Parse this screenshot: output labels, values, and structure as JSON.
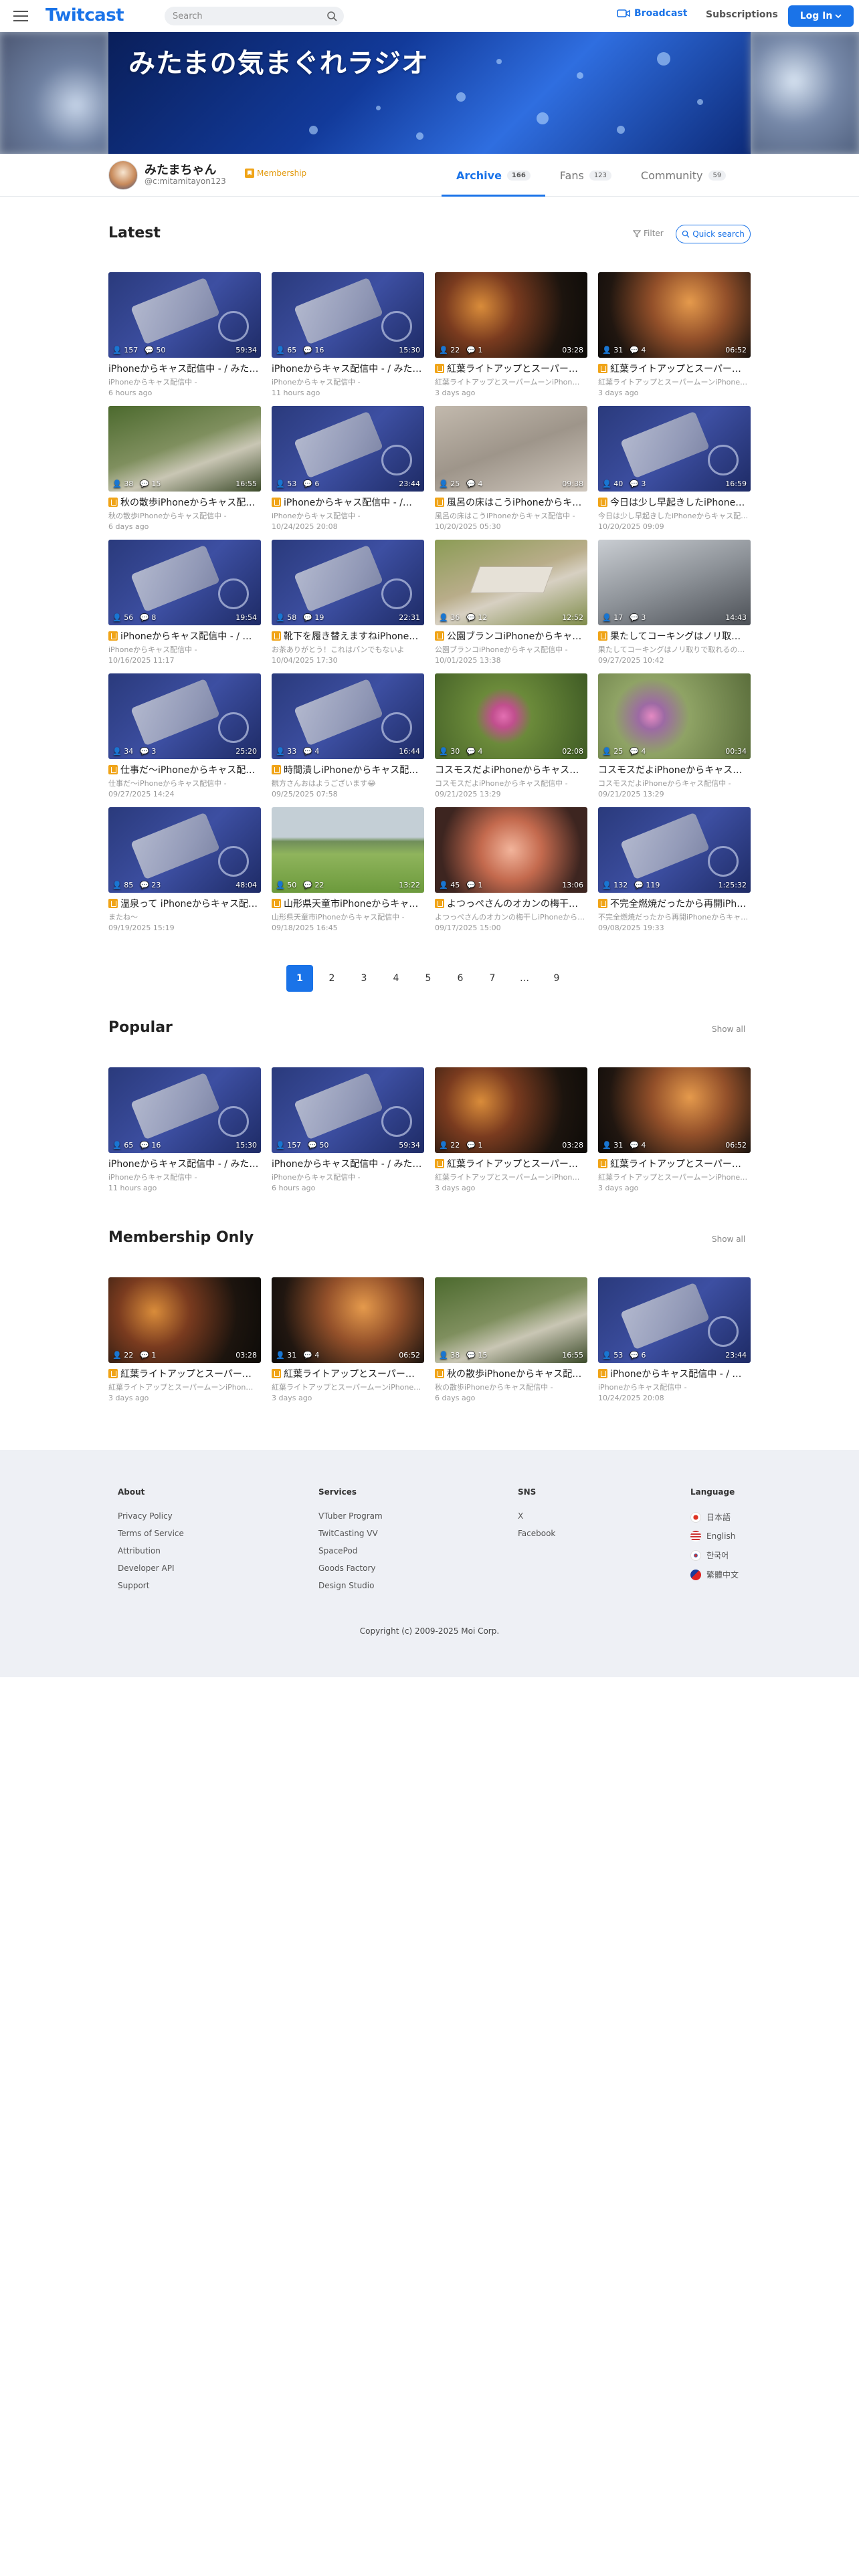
{
  "header": {
    "logo": "Twitcast",
    "search_placeholder": "Search",
    "broadcast": "Broadcast",
    "subscriptions": "Subscriptions",
    "login": "Log In"
  },
  "banner": {
    "title": "みたまの気まぐれラジオ"
  },
  "profile": {
    "name": "みたまちゃん",
    "id": "@c:mitamitayon123",
    "membership": "Membership",
    "tabs": [
      {
        "label": "Archive",
        "count": "166"
      },
      {
        "label": "Fans",
        "count": "123"
      },
      {
        "label": "Community",
        "count": "59"
      }
    ]
  },
  "latest": {
    "title": "Latest",
    "filter": "Filter",
    "quick_search": "Quick search",
    "items": [
      {
        "thumb": "phone",
        "views": "157",
        "comments": "50",
        "dur": "59:34",
        "member": false,
        "title": "iPhoneからキャス配信中 - / みた…",
        "sub": "iPhoneからキャス配信中 -",
        "time": "6 hours ago"
      },
      {
        "thumb": "phone",
        "views": "65",
        "comments": "16",
        "dur": "15:30",
        "member": false,
        "title": "iPhoneからキャス配信中 - / みた…",
        "sub": "iPhoneからキャス配信中 -",
        "time": "11 hours ago"
      },
      {
        "thumb": "autumn",
        "views": "22",
        "comments": "1",
        "dur": "03:28",
        "member": true,
        "title": "紅葉ライトアップとスーパー…",
        "sub": "紅葉ライトアップとスーパームーンiPhon…",
        "time": "3 days ago"
      },
      {
        "thumb": "autumn2",
        "views": "31",
        "comments": "4",
        "dur": "06:52",
        "member": true,
        "title": "紅葉ライトアップとスーパー…",
        "sub": "紅葉ライトアップとスーパームーンiPhone…",
        "time": "3 days ago"
      },
      {
        "thumb": "path",
        "views": "38",
        "comments": "15",
        "dur": "16:55",
        "member": true,
        "title": "秋の散歩iPhoneからキャス配…",
        "sub": "秋の散歩iPhoneからキャス配信中 -",
        "time": "6 days ago"
      },
      {
        "thumb": "phone",
        "views": "53",
        "comments": "6",
        "dur": "23:44",
        "member": true,
        "title": "iPhoneからキャス配信中 - /…",
        "sub": "iPhoneからキャス配信中 -",
        "time": "10/24/2025 20:08"
      },
      {
        "thumb": "bath",
        "views": "25",
        "comments": "4",
        "dur": "09:38",
        "member": true,
        "title": "風呂の床はこうiPhoneからキ…",
        "sub": "風呂の床はこうiPhoneからキャス配信中 -",
        "time": "10/20/2025 05:30"
      },
      {
        "thumb": "phone",
        "views": "40",
        "comments": "3",
        "dur": "16:59",
        "member": true,
        "title": "今日は少し早起きしたiPhone…",
        "sub": "今日は少し早起きしたiPhoneからキャス配…",
        "time": "10/20/2025 09:09"
      },
      {
        "thumb": "phone",
        "views": "56",
        "comments": "8",
        "dur": "19:54",
        "member": true,
        "title": "iPhoneからキャス配信中 - / …",
        "sub": "iPhoneからキャス配信中 -",
        "time": "10/16/2025 11:17"
      },
      {
        "thumb": "phone",
        "views": "58",
        "comments": "19",
        "dur": "22:31",
        "member": true,
        "title": "靴下を履き替えますねiPhone…",
        "sub": "お茶ありがとう！これはパンでもないよ",
        "time": "10/04/2025 17:30"
      },
      {
        "thumb": "bench",
        "views": "36",
        "comments": "12",
        "dur": "12:52",
        "member": true,
        "title": "公園ブランコiPhoneからキャ…",
        "sub": "公園ブランコiPhoneからキャス配信中 -",
        "time": "10/01/2025 13:38"
      },
      {
        "thumb": "car",
        "views": "17",
        "comments": "3",
        "dur": "14:43",
        "member": true,
        "title": "果たしてコーキングはノリ取…",
        "sub": "果たしてコーキングはノリ取りで取れるの…",
        "time": "09/27/2025 10:42"
      },
      {
        "thumb": "phone",
        "views": "34",
        "comments": "3",
        "dur": "25:20",
        "member": true,
        "title": "仕事だ〜iPhoneからキャス配…",
        "sub": "仕事だ〜iPhoneからキャス配信中 -",
        "time": "09/27/2025 14:24"
      },
      {
        "thumb": "phone",
        "views": "33",
        "comments": "4",
        "dur": "16:44",
        "member": true,
        "title": "時間潰しiPhoneからキャス配…",
        "sub": "観方さんおはようございます😂",
        "time": "09/25/2025 07:58"
      },
      {
        "thumb": "cosmos",
        "views": "30",
        "comments": "4",
        "dur": "02:08",
        "member": false,
        "title": "コスモスだよiPhoneからキャス…",
        "sub": "コスモスだよiPhoneからキャス配信中 -",
        "time": "09/21/2025 13:29"
      },
      {
        "thumb": "cosmos2",
        "views": "25",
        "comments": "4",
        "dur": "00:34",
        "member": false,
        "title": "コスモスだよiPhoneからキャス…",
        "sub": "コスモスだよiPhoneからキャス配信中 -",
        "time": "09/21/2025 13:29"
      },
      {
        "thumb": "phone",
        "views": "85",
        "comments": "23",
        "dur": "48:04",
        "member": true,
        "title": "温泉って iPhoneからキャス配…",
        "sub": "またね〜",
        "time": "09/19/2025 15:19"
      },
      {
        "thumb": "field",
        "views": "50",
        "comments": "22",
        "dur": "13:22",
        "member": true,
        "title": "山形県天童市iPhoneからキャ…",
        "sub": "山形県天童市iPhoneからキャス配信中 -",
        "time": "09/18/2025 16:45"
      },
      {
        "thumb": "jar",
        "views": "45",
        "comments": "1",
        "dur": "13:06",
        "member": true,
        "title": "よつっぺさんのオカンの梅干…",
        "sub": "よつっぺさんのオカンの梅干しiPhoneから…",
        "time": "09/17/2025 15:00"
      },
      {
        "thumb": "phone",
        "views": "132",
        "comments": "119",
        "dur": "1:25:32",
        "member": true,
        "title": "不完全燃焼だったから再開iPh…",
        "sub": "不完全燃焼だったから再開iPhoneからキャ…",
        "time": "09/08/2025 19:33"
      }
    ]
  },
  "pager": [
    "1",
    "2",
    "3",
    "4",
    "5",
    "6",
    "7",
    "…",
    "9"
  ],
  "popular": {
    "title": "Popular",
    "show_all": "Show all",
    "items": [
      {
        "thumb": "phone",
        "views": "65",
        "comments": "16",
        "dur": "15:30",
        "member": false,
        "title": "iPhoneからキャス配信中 - / みた…",
        "sub": "iPhoneからキャス配信中 -",
        "time": "11 hours ago"
      },
      {
        "thumb": "phone",
        "views": "157",
        "comments": "50",
        "dur": "59:34",
        "member": false,
        "title": "iPhoneからキャス配信中 - / みた…",
        "sub": "iPhoneからキャス配信中 -",
        "time": "6 hours ago"
      },
      {
        "thumb": "autumn",
        "views": "22",
        "comments": "1",
        "dur": "03:28",
        "member": true,
        "title": "紅葉ライトアップとスーパー…",
        "sub": "紅葉ライトアップとスーパームーンiPhon…",
        "time": "3 days ago"
      },
      {
        "thumb": "autumn2",
        "views": "31",
        "comments": "4",
        "dur": "06:52",
        "member": true,
        "title": "紅葉ライトアップとスーパー…",
        "sub": "紅葉ライトアップとスーパームーンiPhone…",
        "time": "3 days ago"
      }
    ]
  },
  "membership": {
    "title": "Membership Only",
    "show_all": "Show all",
    "items": [
      {
        "thumb": "autumn",
        "views": "22",
        "comments": "1",
        "dur": "03:28",
        "member": true,
        "title": "紅葉ライトアップとスーパー…",
        "sub": "紅葉ライトアップとスーパームーンiPhon…",
        "time": "3 days ago"
      },
      {
        "thumb": "autumn2",
        "views": "31",
        "comments": "4",
        "dur": "06:52",
        "member": true,
        "title": "紅葉ライトアップとスーパー…",
        "sub": "紅葉ライトアップとスーパームーンiPhone…",
        "time": "3 days ago"
      },
      {
        "thumb": "path",
        "views": "38",
        "comments": "15",
        "dur": "16:55",
        "member": true,
        "title": "秋の散歩iPhoneからキャス配…",
        "sub": "秋の散歩iPhoneからキャス配信中 -",
        "time": "6 days ago"
      },
      {
        "thumb": "phone",
        "views": "53",
        "comments": "6",
        "dur": "23:44",
        "member": true,
        "title": "iPhoneからキャス配信中 - / …",
        "sub": "iPhoneからキャス配信中 -",
        "time": "10/24/2025 20:08"
      }
    ]
  },
  "footer": {
    "about": {
      "title": "About",
      "links": [
        "Privacy Policy",
        "Terms of Service",
        "Attribution",
        "Developer API",
        "Support"
      ]
    },
    "services": {
      "title": "Services",
      "links": [
        "VTuber Program",
        "TwitCasting VV",
        "SpacePod",
        "Goods Factory",
        "Design Studio"
      ]
    },
    "sns": {
      "title": "SNS",
      "links": [
        "X",
        "Facebook"
      ]
    },
    "language": {
      "title": "Language",
      "links": [
        "日本語",
        "English",
        "한국어",
        "繁體中文"
      ]
    },
    "copyright": "Copyright (c) 2009-2025 Moi Corp."
  },
  "colors": {
    "accent": "#1a73e8",
    "member": "#f0a418"
  }
}
